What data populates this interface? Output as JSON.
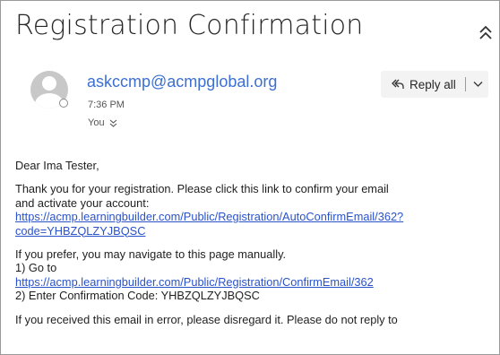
{
  "email": {
    "subject": "Registration Confirmation",
    "sender": "askccmp@acmpglobal.org",
    "time": "7:36 PM",
    "to": "You",
    "reply_all_label": "Reply all"
  },
  "body": {
    "greeting": "Dear Ima Tester,",
    "para1_line1": "Thank you for your registration.  Please click this link to confirm your email",
    "para1_line2": "and activate your account:",
    "link1_line1": "https://acmp.learningbuilder.com/Public/Registration/AutoConfirmEmail/362?",
    "link1_line2": "code=YHBZQLZYJBQSC",
    "para2_line1": "If you prefer, you may navigate to this page manually.",
    "step1": "1) Go to",
    "link2": "https://acmp.learningbuilder.com/Public/Registration/ConfirmEmail/362",
    "step2": "2) Enter Confirmation Code: YHBZQLZYJBQSC",
    "para3_line1": "If you received this email in error, please disregard it. Please do not reply to"
  },
  "icons": {
    "collapse": "double-chevron-up-icon",
    "avatar": "person-avatar-icon",
    "expand_recipients": "double-chevron-down-icon",
    "reply_all": "reply-all-icon",
    "more": "chevron-down-icon"
  },
  "colors": {
    "sender": "#3c6fd1",
    "link": "#2a52c9"
  }
}
